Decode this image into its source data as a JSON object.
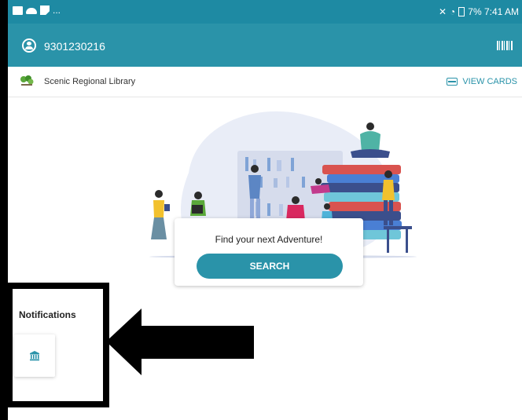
{
  "status_bar": {
    "right_text": "7% 7:41 AM",
    "icons": [
      "image-icon",
      "cloud-icon",
      "flipboard-icon",
      "more-dots-icon",
      "mute-icon",
      "wifi-icon",
      "battery-icon"
    ],
    "more_dots": "..."
  },
  "app_bar": {
    "card_number": "9301230216",
    "icons": [
      "account-icon",
      "barcode-icon"
    ],
    "color": "#2a93a9"
  },
  "library_bar": {
    "library_name": "Scenic Regional Library",
    "view_cards_label": "VIEW CARDS"
  },
  "hero": {
    "prompt_text": "Find your next Adventure!",
    "search_label": "SEARCH"
  },
  "notifications": {
    "heading": "Notifications",
    "tile_icon": "bank-icon"
  },
  "annotation": {
    "callout_color": "#000000",
    "arrow_icon": "left-arrow-icon"
  }
}
